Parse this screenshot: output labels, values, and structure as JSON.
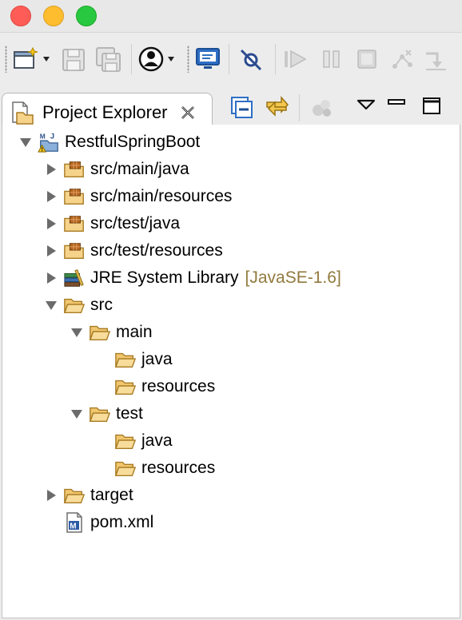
{
  "view": {
    "title": "Project Explorer",
    "close_glyph": "⨯"
  },
  "toolbar": {
    "buttons": [
      "new-icon",
      "save-icon",
      "save-all-icon",
      "perspective-icon",
      "monitor-icon",
      "skip-breakpoints-icon",
      "resume-icon",
      "suspend-icon",
      "terminate-icon",
      "disconnect-icon",
      "step-into-icon"
    ]
  },
  "view_toolbar": {
    "buttons": [
      "collapse-all-icon",
      "link-with-editor-icon",
      "focus-icon",
      "view-menu-icon",
      "minimize-icon",
      "maximize-icon"
    ]
  },
  "tree": [
    {
      "label": "RestfulSpringBoot",
      "depth": 0,
      "expanded": true,
      "icon": "maven-project-icon"
    },
    {
      "label": "src/main/java",
      "depth": 1,
      "expanded": false,
      "icon": "source-folder-icon"
    },
    {
      "label": "src/main/resources",
      "depth": 1,
      "expanded": false,
      "icon": "source-folder-icon"
    },
    {
      "label": "src/test/java",
      "depth": 1,
      "expanded": false,
      "icon": "source-folder-icon"
    },
    {
      "label": "src/test/resources",
      "depth": 1,
      "expanded": false,
      "icon": "source-folder-icon"
    },
    {
      "label": "JRE System Library",
      "decoration": "[JavaSE-1.6]",
      "depth": 1,
      "expanded": false,
      "icon": "library-icon"
    },
    {
      "label": "src",
      "depth": 1,
      "expanded": true,
      "icon": "folder-open-icon"
    },
    {
      "label": "main",
      "depth": 2,
      "expanded": true,
      "icon": "folder-open-icon"
    },
    {
      "label": "java",
      "depth": 3,
      "leaf": true,
      "icon": "folder-icon"
    },
    {
      "label": "resources",
      "depth": 3,
      "leaf": true,
      "icon": "folder-icon"
    },
    {
      "label": "test",
      "depth": 2,
      "expanded": true,
      "icon": "folder-open-icon"
    },
    {
      "label": "java",
      "depth": 3,
      "leaf": true,
      "icon": "folder-icon"
    },
    {
      "label": "resources",
      "depth": 3,
      "leaf": true,
      "icon": "folder-icon"
    },
    {
      "label": "target",
      "depth": 1,
      "expanded": false,
      "icon": "folder-icon"
    },
    {
      "label": "pom.xml",
      "depth": 1,
      "leaf": true,
      "icon": "maven-pom-icon"
    }
  ],
  "colors": {
    "folder_fill": "#f6d38a",
    "folder_stroke": "#a87b23",
    "decoration": "#927a3e",
    "twistie": "#6b6b6b"
  }
}
